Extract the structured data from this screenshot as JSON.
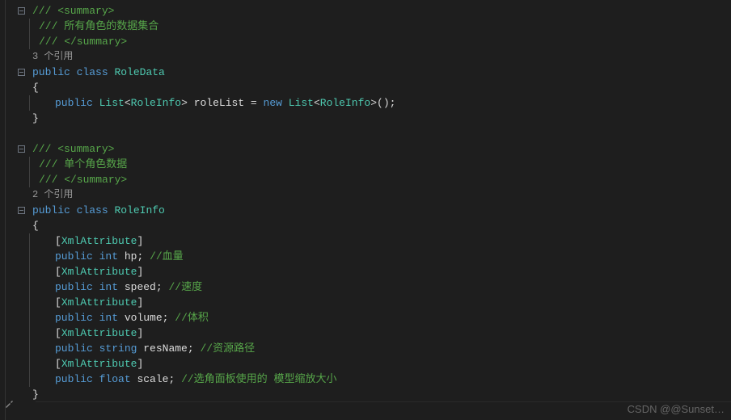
{
  "code": {
    "summary1_open": "/// <summary>",
    "summary1_desc": "/// 所有角色的数据集合",
    "summary1_close": "/// </summary>",
    "refs1": "3 个引用",
    "class1_public": "public",
    "class1_class": "class",
    "class1_name": "RoleData",
    "brace_open": "{",
    "brace_close": "}",
    "field1_public": "public",
    "field1_list": "List",
    "field1_roleinfo": "RoleInfo",
    "field1_name": "roleList",
    "field1_eq": " = ",
    "field1_new": "new",
    "field1_paren": "();",
    "summary2_open": "/// <summary>",
    "summary2_desc": "/// 单个角色数据",
    "summary2_close": "/// </summary>",
    "refs2": "2 个引用",
    "class2_name": "RoleInfo",
    "attr": "XmlAttribute",
    "f_hp_type": "int",
    "f_hp_name": "hp;",
    "f_hp_comment": "//血量",
    "f_speed_type": "int",
    "f_speed_name": "speed;",
    "f_speed_comment": "//速度",
    "f_volume_type": "int",
    "f_volume_name": "volume;",
    "f_volume_comment": "//体积",
    "f_resname_type": "string",
    "f_resname_name": "resName;",
    "f_resname_comment": "//资源路径",
    "f_scale_type": "float",
    "f_scale_name": "scale;",
    "f_scale_comment": "//选角面板使用的 模型缩放大小",
    "lt": "<",
    "gt": ">",
    "lb": "[",
    "rb": "]"
  },
  "watermark": "CSDN @@Sunset…"
}
